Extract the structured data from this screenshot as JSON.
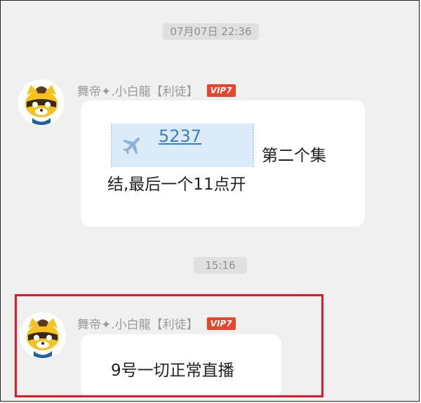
{
  "timestamps": [
    "07月07日 22:36",
    "15:16"
  ],
  "messages": [
    {
      "sender": "舞帝✦.小白龍【利徒】",
      "vip": "VIP7",
      "flight_number": "5237",
      "line1_after_tag": "第二个集",
      "line2": "结,最后一个11点开"
    },
    {
      "sender": "舞帝✦.小白龍【利徒】",
      "vip": "VIP7",
      "text": "9号一切正常直播"
    }
  ],
  "colors": {
    "vip_badge": "#e8462c",
    "link": "#3a7fcf",
    "highlight_border": "#e2172a"
  },
  "icons": [
    "avatar-raccoon-icon",
    "airplane-icon"
  ]
}
